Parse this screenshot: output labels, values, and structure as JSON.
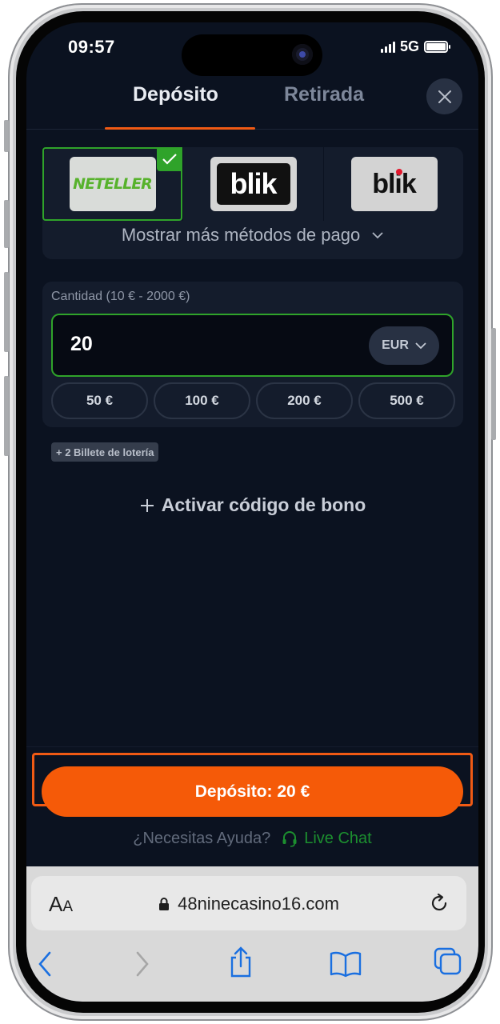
{
  "status_bar": {
    "time": "09:57",
    "network": "5G"
  },
  "tabs": [
    {
      "label": "Depósito",
      "active": true
    },
    {
      "label": "Retirada",
      "active": false
    }
  ],
  "payment_methods": {
    "items": [
      {
        "name": "NETELLER",
        "selected": true
      },
      {
        "name": "blik",
        "selected": false
      },
      {
        "name": "blik",
        "selected": false
      }
    ],
    "show_more_label": "Mostrar más métodos de pago"
  },
  "amount": {
    "label": "Cantidad (10 € - 2000 €)",
    "value": "20",
    "currency": "EUR",
    "presets": [
      "50 €",
      "100 €",
      "200 €",
      "500 €"
    ]
  },
  "lottery_badge": "+ 2 Billete de lotería",
  "bonus_label": "Activar código de bono",
  "deposit_button": "Depósito: 20 €",
  "help": {
    "question": "¿Necesitas Ayuda?",
    "live_chat": "Live Chat"
  },
  "browser": {
    "aa_label": "A",
    "aa_small": "A",
    "url": "48ninecasino16.com"
  },
  "colors": {
    "accent": "#f55a08",
    "selected": "#2fa32a",
    "background": "#0b1220",
    "panel": "#141c2c"
  }
}
